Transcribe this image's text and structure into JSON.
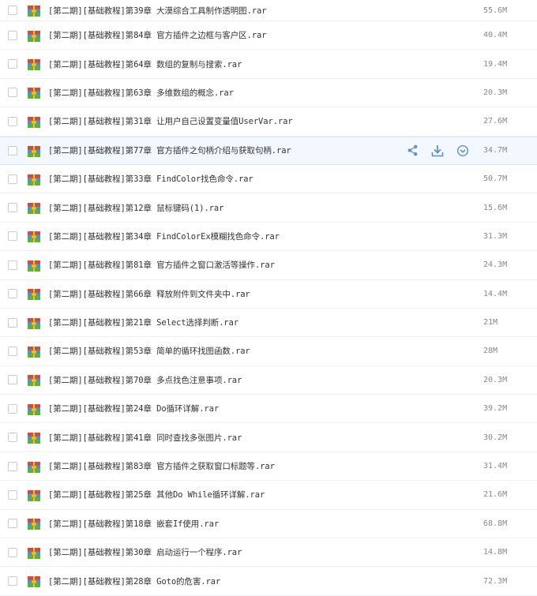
{
  "colors": {
    "accent": "#4a90d9",
    "row_hover": "#f3f8fe"
  },
  "files": [
    {
      "name": "[第二期][基础教程]第39章 大漠综合工具制作透明图.rar",
      "size": "55.6M"
    },
    {
      "name": "[第二期][基础教程]第84章 官方插件之边框与客户区.rar",
      "size": "40.4M"
    },
    {
      "name": "[第二期][基础教程]第64章 数组的复制与搜索.rar",
      "size": "19.4M"
    },
    {
      "name": "[第二期][基础教程]第63章 多维数组的概念.rar",
      "size": "20.3M"
    },
    {
      "name": "[第二期][基础教程]第31章 让用户自己设置变量值UserVar.rar",
      "size": "27.6M"
    },
    {
      "name": "[第二期][基础教程]第77章 官方插件之句柄介绍与获取句柄.rar",
      "size": "34.7M"
    },
    {
      "name": "[第二期][基础教程]第33章 FindColor找色命令.rar",
      "size": "50.7M"
    },
    {
      "name": "[第二期][基础教程]第12章 鼠标键码(1).rar",
      "size": "15.6M"
    },
    {
      "name": "[第二期][基础教程]第34章 FindColorEx模糊找色命令.rar",
      "size": "31.3M"
    },
    {
      "name": "[第二期][基础教程]第81章 官方插件之窗口激活等操作.rar",
      "size": "24.3M"
    },
    {
      "name": "[第二期][基础教程]第66章 释放附件到文件夹中.rar",
      "size": "14.4M"
    },
    {
      "name": "[第二期][基础教程]第21章 Select选择判断.rar",
      "size": "21M"
    },
    {
      "name": "[第二期][基础教程]第53章 简单的循环找图函数.rar",
      "size": "28M"
    },
    {
      "name": "[第二期][基础教程]第70章 多点找色注意事项.rar",
      "size": "20.3M"
    },
    {
      "name": "[第二期][基础教程]第24章 Do循环详解.rar",
      "size": "39.2M"
    },
    {
      "name": "[第二期][基础教程]第41章 同时查找多张图片.rar",
      "size": "30.2M"
    },
    {
      "name": "[第二期][基础教程]第83章 官方插件之获取窗口标题等.rar",
      "size": "31.4M"
    },
    {
      "name": "[第二期][基础教程]第25章 其他Do While循环详解.rar",
      "size": "21.6M"
    },
    {
      "name": "[第二期][基础教程]第18章 嵌套If使用.rar",
      "size": "68.8M"
    },
    {
      "name": "[第二期][基础教程]第30章 启动运行一个程序.rar",
      "size": "14.8M"
    },
    {
      "name": "[第二期][基础教程]第28章 Goto的危害.rar",
      "size": "72.3M"
    }
  ],
  "hovered_row": 5,
  "row_actions": [
    "share-icon",
    "download-icon",
    "more-icon"
  ]
}
